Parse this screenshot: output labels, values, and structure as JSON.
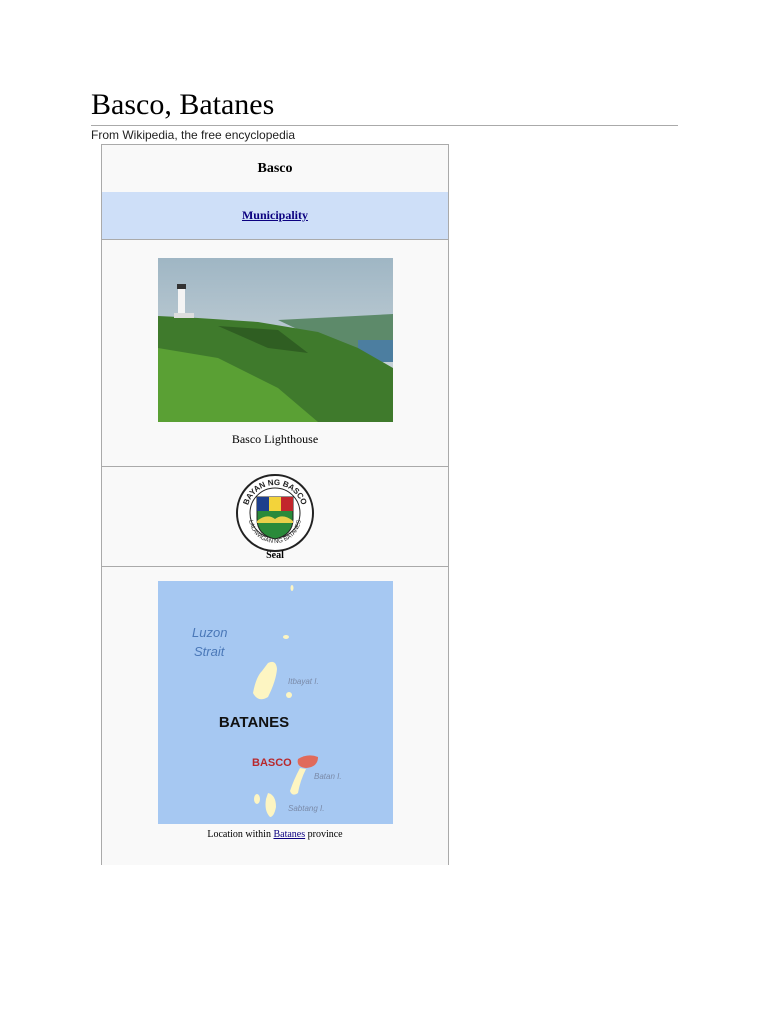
{
  "page": {
    "title": "Basco, Batanes",
    "subtitle": "From Wikipedia, the free encyclopedia"
  },
  "infobox": {
    "name": "Basco",
    "type_link": "Municipality",
    "photo_caption": "Basco Lighthouse",
    "seal": {
      "caption": "Seal",
      "text_top": "BAYAN NG BASCO",
      "text_bottom": "LALAWIGAN NG BATANES"
    },
    "map": {
      "labels": {
        "strait": "Luzon",
        "strait2": "Strait",
        "itbayat": "Itbayat I.",
        "province": "BATANES",
        "town": "BASCO",
        "batan": "Batan I.",
        "sabtang": "Sabtang I."
      },
      "caption_pre": "Location within",
      "caption_link": "Batanes",
      "caption_post": "province"
    }
  },
  "colors": {
    "highlight": "#e06a5a",
    "sea": "#a6c8f2",
    "land": "#fdf5c2",
    "header_band": "#cedff8"
  }
}
